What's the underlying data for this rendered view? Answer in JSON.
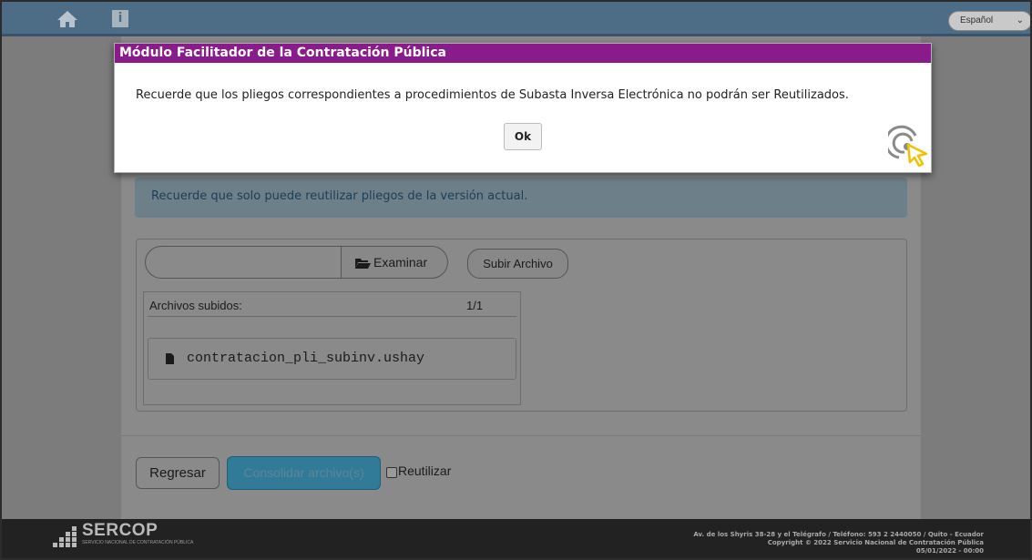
{
  "header": {
    "home_icon": "home-icon",
    "info_icon": "info-icon",
    "info_glyph": "i",
    "language": "Español"
  },
  "alert": {
    "text": "Recuerde que solo puede reutilizar pliegos de la versión actual."
  },
  "upload": {
    "file_value": "",
    "browse_label": "Examinar",
    "upload_label": "Subir Archivo",
    "files_header": "Archivos subidos:",
    "files_count": "1/1",
    "files": [
      {
        "name": "contratacion_pli_subinv.ushay"
      }
    ]
  },
  "actions": {
    "back_label": "Regresar",
    "consolidate_label": "Consolidar archivo(s)",
    "reuse_label": "Reutilizar",
    "reuse_checked": false
  },
  "footer": {
    "logo_text": "SERCOP",
    "logo_sub": "SERVICIO NACIONAL DE CONTRATACIÓN PÚBLICA",
    "line1": "Av. de los Shyris 38-28 y el Telégrafo / Teléfono: 593 2 2440050 / Quito - Ecuador",
    "line2": "Copyright © 2022 Servicio Nacional de Contratación Pública",
    "line3": "05/01/2022 - 00:00"
  },
  "modal": {
    "title": "Módulo Facilitador de la Contratación Pública",
    "message": "Recuerde que los pliegos correspondientes a procedimientos de Subasta Inversa Electrónica no podrán ser Reutilizados.",
    "ok_label": "Ok"
  },
  "colors": {
    "topbar": "#4d6c86",
    "modal_title_bg": "#8a1b8a",
    "primary_button": "#317b99",
    "footer_bg": "#222222"
  }
}
